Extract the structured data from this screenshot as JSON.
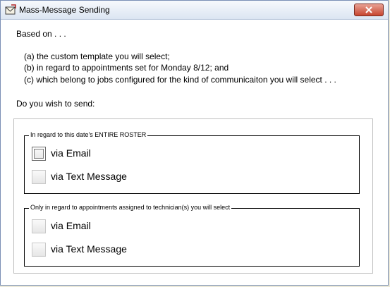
{
  "window": {
    "title": "Mass-Message Sending",
    "icon": "app-envelope-icon",
    "close_icon": "close-icon"
  },
  "body": {
    "intro": "Based on . . .",
    "lines": [
      "(a) the custom template you will select;",
      "(b) in regard to appointments set for Monday 8/12; and",
      "(c) which belong to jobs configured for the kind of communicaiton you will select . . ."
    ],
    "question": "Do you wish to send:"
  },
  "groups": [
    {
      "title": "In regard to this date's ENTIRE ROSTER",
      "options": [
        {
          "label": "via Email",
          "checked": false,
          "focused": true
        },
        {
          "label": "via Text Message",
          "checked": false,
          "focused": false
        }
      ]
    },
    {
      "title": "Only in regard to appointments assigned to technician(s) you will select",
      "options": [
        {
          "label": "via Email",
          "checked": false,
          "focused": false
        },
        {
          "label": "via Text Message",
          "checked": false,
          "focused": false
        }
      ]
    }
  ],
  "colors": {
    "close_button": "#c7452f",
    "titlebar": "#dbe5f2"
  }
}
